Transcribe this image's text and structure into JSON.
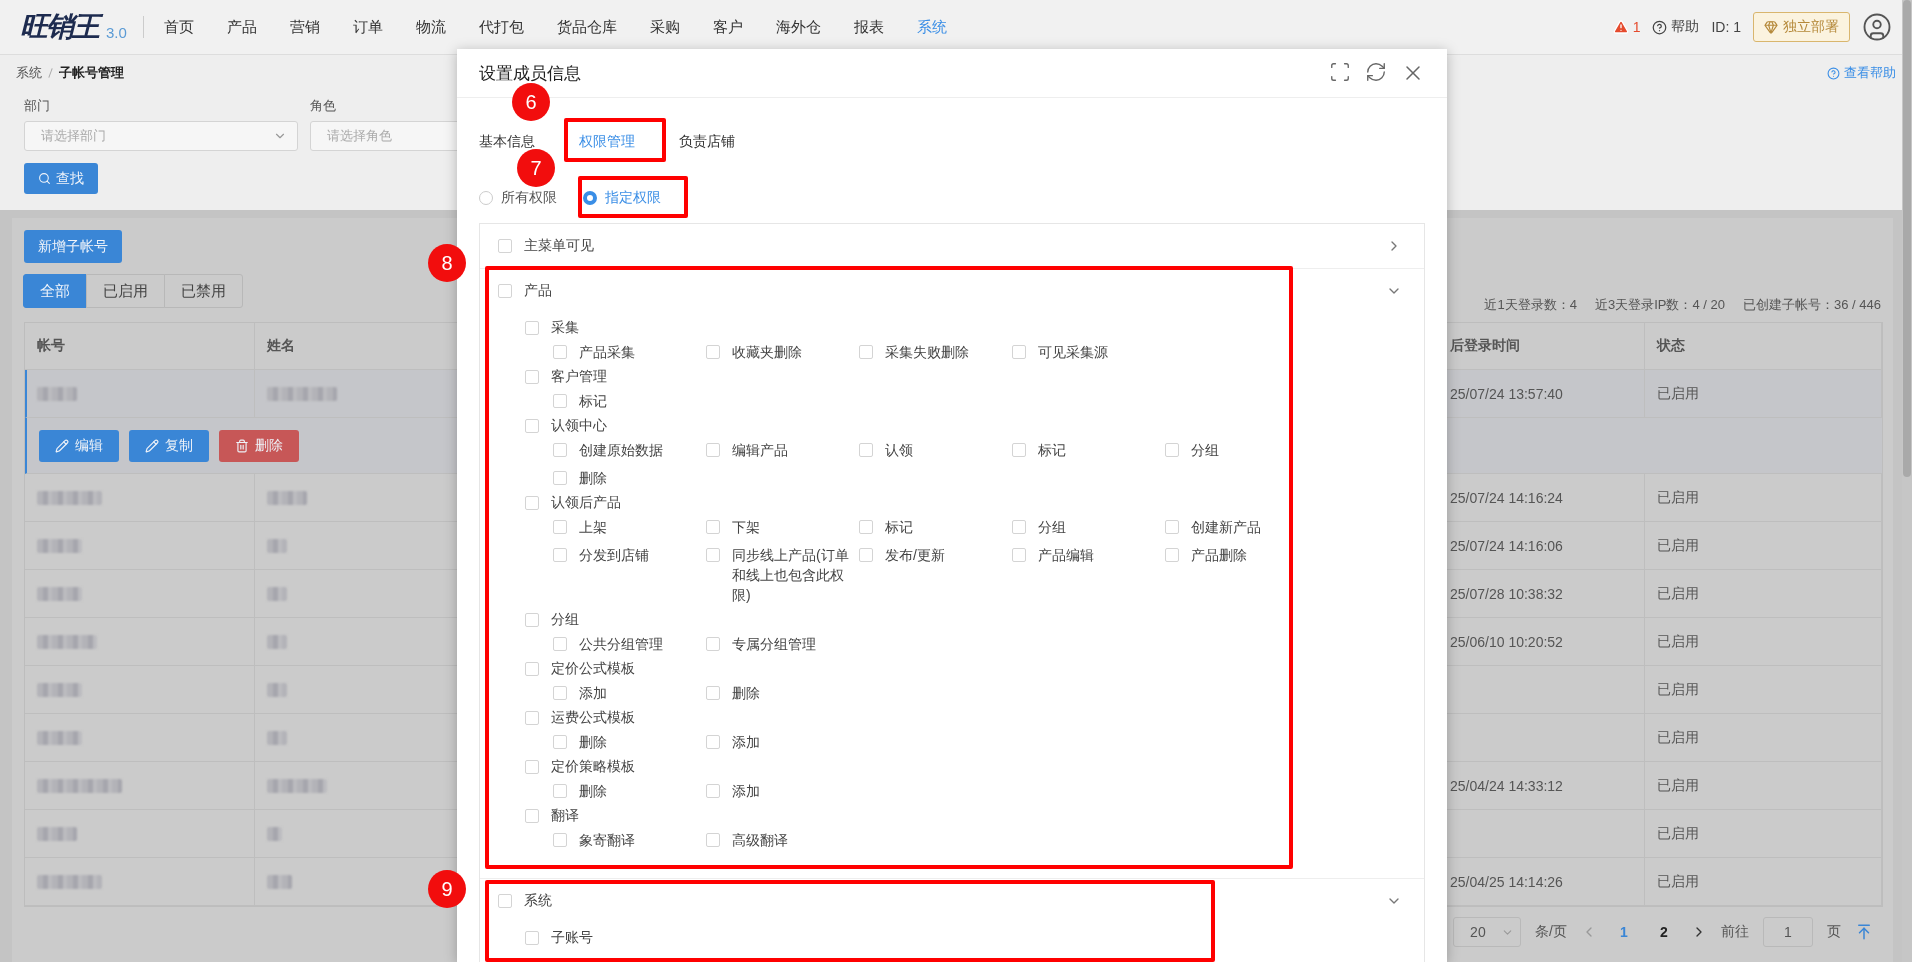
{
  "nav": {
    "logo": "旺销王",
    "version": "3.0",
    "menu": [
      {
        "label": "首页",
        "selected": false
      },
      {
        "label": "产品",
        "selected": false
      },
      {
        "label": "营销",
        "selected": false
      },
      {
        "label": "订单",
        "selected": false
      },
      {
        "label": "物流",
        "selected": false
      },
      {
        "label": "代打包",
        "selected": false
      },
      {
        "label": "货品仓库",
        "selected": false
      },
      {
        "label": "采购",
        "selected": false
      },
      {
        "label": "客户",
        "selected": false
      },
      {
        "label": "海外仓",
        "selected": false
      },
      {
        "label": "报表",
        "selected": false
      },
      {
        "label": "系统",
        "selected": true
      }
    ],
    "alert_count": "1",
    "help": "帮助",
    "id_label": "ID: 1",
    "deploy": "独立部署"
  },
  "breadcrumb": [
    "系统",
    "子帐号管理"
  ],
  "help_link": "查看帮助",
  "filters": [
    {
      "label": "部门",
      "placeholder": "请选择部门"
    },
    {
      "label": "角色",
      "placeholder": "请选择角色"
    }
  ],
  "search_button": "查找",
  "add_button": "新增子帐号",
  "status_tabs": [
    {
      "label": "全部",
      "selected": true
    },
    {
      "label": "已启用",
      "selected": false
    },
    {
      "label": "已禁用",
      "selected": false
    }
  ],
  "stats": [
    "近1天登录数：4",
    "近3天登录IP数：4 / 20",
    "已创建子帐号：36 / 446"
  ],
  "table": {
    "columns": [
      "帐号",
      "姓名",
      "后登录时间",
      "状态"
    ],
    "row_actions": [
      {
        "kind": "edit",
        "label": "编辑"
      },
      {
        "kind": "copy",
        "label": "复制"
      },
      {
        "kind": "delete",
        "label": "删除"
      }
    ],
    "rows": [
      {
        "login_time": "25/07/24 13:57:40",
        "status": "已启用",
        "selected": true,
        "expanded": true
      },
      {
        "login_time": "25/07/24 14:16:24",
        "status": "已启用",
        "selected": false,
        "expanded": false
      },
      {
        "login_time": "25/07/24 14:16:06",
        "status": "已启用",
        "selected": false,
        "expanded": false
      },
      {
        "login_time": "25/07/28 10:38:32",
        "status": "已启用",
        "selected": false,
        "expanded": false
      },
      {
        "login_time": "25/06/10 10:20:52",
        "status": "已启用",
        "selected": false,
        "expanded": false
      },
      {
        "status": "已启用",
        "selected": false,
        "expanded": false
      },
      {
        "status": "已启用",
        "selected": false,
        "expanded": false
      },
      {
        "login_time": "25/04/24 14:33:12",
        "status": "已启用",
        "selected": false,
        "expanded": false
      },
      {
        "status": "已启用",
        "selected": false,
        "expanded": false
      },
      {
        "login_time": "25/04/25 14:14:26",
        "status": "已启用",
        "selected": false,
        "expanded": false
      }
    ]
  },
  "pagination": {
    "page_size": "20",
    "per_page": "条/页",
    "pages": [
      {
        "label": "1",
        "selected": true
      },
      {
        "label": "2",
        "selected": false
      }
    ],
    "goto": "前往",
    "goto_value": "1",
    "page_suffix": "页"
  },
  "dialog": {
    "title": "设置成员信息",
    "tabs": [
      {
        "label": "基本信息",
        "selected": false
      },
      {
        "label": "权限管理",
        "selected": true
      },
      {
        "label": "负责店铺",
        "selected": false
      }
    ],
    "radios": [
      {
        "label": "所有权限",
        "selected": false
      },
      {
        "label": "指定权限",
        "selected": true
      }
    ],
    "panels": [
      {
        "label": "主菜单可见",
        "checked": false,
        "expanded": false
      },
      {
        "label": "产品",
        "checked": false,
        "expanded": true,
        "children": [
          {
            "label": "采集",
            "checked": false,
            "children": [
              {
                "label": "产品采集",
                "checked": false
              },
              {
                "label": "收藏夹删除",
                "checked": false
              },
              {
                "label": "采集失败删除",
                "checked": false
              },
              {
                "label": "可见采集源",
                "checked": false
              }
            ]
          },
          {
            "label": "客户管理",
            "checked": false,
            "children": [
              {
                "label": "标记",
                "checked": false
              }
            ]
          },
          {
            "label": "认领中心",
            "checked": false,
            "children": [
              {
                "label": "创建原始数据",
                "checked": false
              },
              {
                "label": "编辑产品",
                "checked": false
              },
              {
                "label": "认领",
                "checked": false
              },
              {
                "label": "标记",
                "checked": false
              },
              {
                "label": "分组",
                "checked": false
              },
              {
                "label": "删除",
                "checked": false
              }
            ]
          },
          {
            "label": "认领后产品",
            "checked": false,
            "children": [
              {
                "label": "上架",
                "checked": false
              },
              {
                "label": "下架",
                "checked": false
              },
              {
                "label": "标记",
                "checked": false
              },
              {
                "label": "分组",
                "checked": false
              },
              {
                "label": "创建新产品",
                "checked": false
              },
              {
                "label": "分发到店铺",
                "checked": false
              },
              {
                "label": "同步线上产品(订单和线上也包含此权限)",
                "checked": false
              },
              {
                "label": "发布/更新",
                "checked": false
              },
              {
                "label": "产品编辑",
                "checked": false
              },
              {
                "label": "产品删除",
                "checked": false
              }
            ]
          },
          {
            "label": "分组",
            "checked": false,
            "children": [
              {
                "label": "公共分组管理",
                "checked": false
              },
              {
                "label": "专属分组管理",
                "checked": false
              }
            ]
          },
          {
            "label": "定价公式模板",
            "checked": false,
            "children": [
              {
                "label": "添加",
                "checked": false
              },
              {
                "label": "删除",
                "checked": false
              }
            ]
          },
          {
            "label": "运费公式模板",
            "checked": false,
            "children": [
              {
                "label": "删除",
                "checked": false
              },
              {
                "label": "添加",
                "checked": false
              }
            ]
          },
          {
            "label": "定价策略模板",
            "checked": false,
            "children": [
              {
                "label": "删除",
                "checked": false
              },
              {
                "label": "添加",
                "checked": false
              }
            ]
          },
          {
            "label": "翻译",
            "checked": false,
            "children": [
              {
                "label": "象寄翻译",
                "checked": false
              },
              {
                "label": "高级翻译",
                "checked": false
              }
            ]
          }
        ]
      },
      {
        "label": "系统",
        "checked": false,
        "expanded": true,
        "children": [
          {
            "label": "子账号",
            "checked": false
          }
        ]
      }
    ]
  },
  "markers": [
    {
      "label": "6"
    },
    {
      "label": "7"
    },
    {
      "label": "8"
    },
    {
      "label": "9"
    }
  ]
}
